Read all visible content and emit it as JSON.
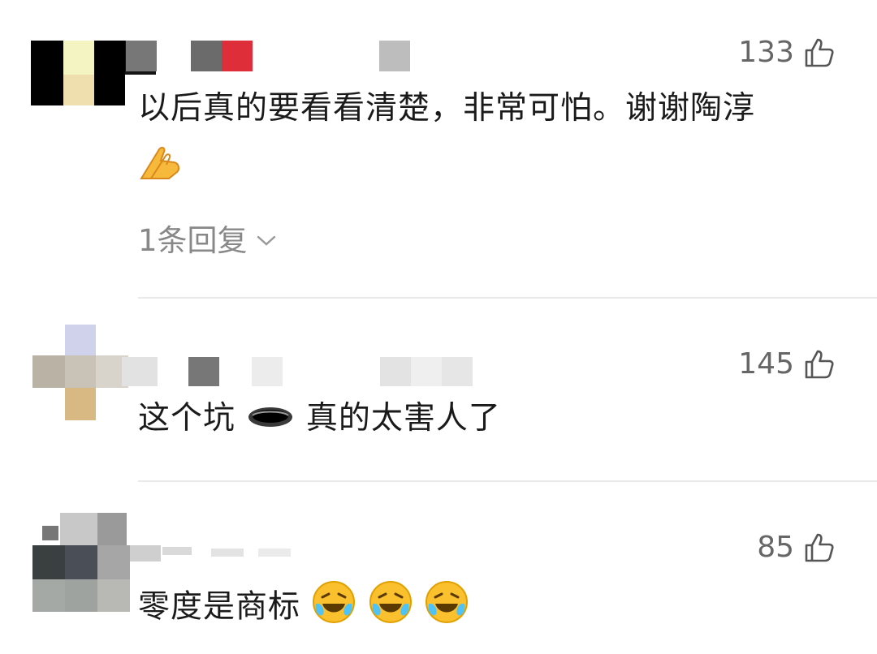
{
  "comments": [
    {
      "likes": "133",
      "text": "以后真的要看看清楚，非常可怕。谢谢陶淳",
      "replies_label": "1条回复"
    },
    {
      "likes": "145",
      "text_before": "这个坑",
      "text_after": "真的太害人了"
    },
    {
      "likes": "85",
      "text": "零度是商标"
    }
  ],
  "icons": {
    "like": "thumbs-up-icon",
    "expand": "chevron-down-icon",
    "emoji_hands": "folded-hands-emoji-icon",
    "emoji_hole": "hole-emoji-icon",
    "emoji_laugh": "rolling-laughing-emoji-icon"
  },
  "colors": {
    "text": "#1a1a1a",
    "meta": "#666666",
    "reply": "#888888",
    "divider": "#e9e9e9"
  }
}
